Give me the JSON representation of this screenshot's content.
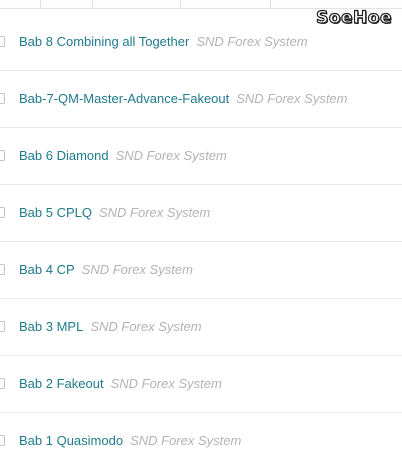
{
  "watermark": "SoeHoe",
  "items": [
    {
      "title": "Bab 8 Combining all Together",
      "meta": "SND Forex System"
    },
    {
      "title": "Bab-7-QM-Master-Advance-Fakeout",
      "meta": "SND Forex System"
    },
    {
      "title": "Bab 6 Diamond",
      "meta": "SND Forex System"
    },
    {
      "title": "Bab 5 CPLQ",
      "meta": "SND Forex System"
    },
    {
      "title": "Bab 4 CP",
      "meta": "SND Forex System"
    },
    {
      "title": "Bab 3 MPL",
      "meta": "SND Forex System"
    },
    {
      "title": "Bab 2 Fakeout",
      "meta": "SND Forex System"
    },
    {
      "title": "Bab 1 Quasimodo",
      "meta": "SND Forex System"
    }
  ]
}
